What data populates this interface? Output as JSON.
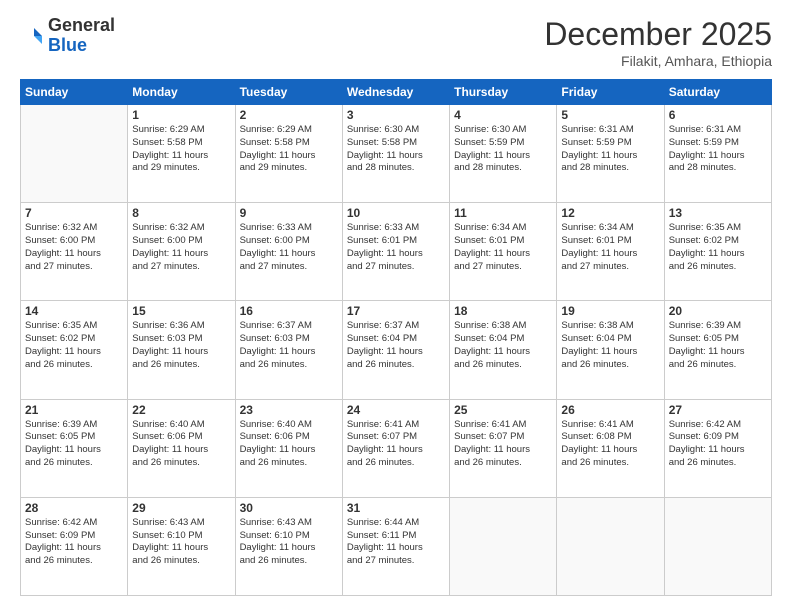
{
  "logo": {
    "general": "General",
    "blue": "Blue"
  },
  "header": {
    "month": "December 2025",
    "location": "Filakit, Amhara, Ethiopia"
  },
  "weekdays": [
    "Sunday",
    "Monday",
    "Tuesday",
    "Wednesday",
    "Thursday",
    "Friday",
    "Saturday"
  ],
  "weeks": [
    [
      {
        "day": "",
        "info": ""
      },
      {
        "day": "1",
        "info": "Sunrise: 6:29 AM\nSunset: 5:58 PM\nDaylight: 11 hours\nand 29 minutes."
      },
      {
        "day": "2",
        "info": "Sunrise: 6:29 AM\nSunset: 5:58 PM\nDaylight: 11 hours\nand 29 minutes."
      },
      {
        "day": "3",
        "info": "Sunrise: 6:30 AM\nSunset: 5:58 PM\nDaylight: 11 hours\nand 28 minutes."
      },
      {
        "day": "4",
        "info": "Sunrise: 6:30 AM\nSunset: 5:59 PM\nDaylight: 11 hours\nand 28 minutes."
      },
      {
        "day": "5",
        "info": "Sunrise: 6:31 AM\nSunset: 5:59 PM\nDaylight: 11 hours\nand 28 minutes."
      },
      {
        "day": "6",
        "info": "Sunrise: 6:31 AM\nSunset: 5:59 PM\nDaylight: 11 hours\nand 28 minutes."
      }
    ],
    [
      {
        "day": "7",
        "info": "Sunrise: 6:32 AM\nSunset: 6:00 PM\nDaylight: 11 hours\nand 27 minutes."
      },
      {
        "day": "8",
        "info": "Sunrise: 6:32 AM\nSunset: 6:00 PM\nDaylight: 11 hours\nand 27 minutes."
      },
      {
        "day": "9",
        "info": "Sunrise: 6:33 AM\nSunset: 6:00 PM\nDaylight: 11 hours\nand 27 minutes."
      },
      {
        "day": "10",
        "info": "Sunrise: 6:33 AM\nSunset: 6:01 PM\nDaylight: 11 hours\nand 27 minutes."
      },
      {
        "day": "11",
        "info": "Sunrise: 6:34 AM\nSunset: 6:01 PM\nDaylight: 11 hours\nand 27 minutes."
      },
      {
        "day": "12",
        "info": "Sunrise: 6:34 AM\nSunset: 6:01 PM\nDaylight: 11 hours\nand 27 minutes."
      },
      {
        "day": "13",
        "info": "Sunrise: 6:35 AM\nSunset: 6:02 PM\nDaylight: 11 hours\nand 26 minutes."
      }
    ],
    [
      {
        "day": "14",
        "info": "Sunrise: 6:35 AM\nSunset: 6:02 PM\nDaylight: 11 hours\nand 26 minutes."
      },
      {
        "day": "15",
        "info": "Sunrise: 6:36 AM\nSunset: 6:03 PM\nDaylight: 11 hours\nand 26 minutes."
      },
      {
        "day": "16",
        "info": "Sunrise: 6:37 AM\nSunset: 6:03 PM\nDaylight: 11 hours\nand 26 minutes."
      },
      {
        "day": "17",
        "info": "Sunrise: 6:37 AM\nSunset: 6:04 PM\nDaylight: 11 hours\nand 26 minutes."
      },
      {
        "day": "18",
        "info": "Sunrise: 6:38 AM\nSunset: 6:04 PM\nDaylight: 11 hours\nand 26 minutes."
      },
      {
        "day": "19",
        "info": "Sunrise: 6:38 AM\nSunset: 6:04 PM\nDaylight: 11 hours\nand 26 minutes."
      },
      {
        "day": "20",
        "info": "Sunrise: 6:39 AM\nSunset: 6:05 PM\nDaylight: 11 hours\nand 26 minutes."
      }
    ],
    [
      {
        "day": "21",
        "info": "Sunrise: 6:39 AM\nSunset: 6:05 PM\nDaylight: 11 hours\nand 26 minutes."
      },
      {
        "day": "22",
        "info": "Sunrise: 6:40 AM\nSunset: 6:06 PM\nDaylight: 11 hours\nand 26 minutes."
      },
      {
        "day": "23",
        "info": "Sunrise: 6:40 AM\nSunset: 6:06 PM\nDaylight: 11 hours\nand 26 minutes."
      },
      {
        "day": "24",
        "info": "Sunrise: 6:41 AM\nSunset: 6:07 PM\nDaylight: 11 hours\nand 26 minutes."
      },
      {
        "day": "25",
        "info": "Sunrise: 6:41 AM\nSunset: 6:07 PM\nDaylight: 11 hours\nand 26 minutes."
      },
      {
        "day": "26",
        "info": "Sunrise: 6:41 AM\nSunset: 6:08 PM\nDaylight: 11 hours\nand 26 minutes."
      },
      {
        "day": "27",
        "info": "Sunrise: 6:42 AM\nSunset: 6:09 PM\nDaylight: 11 hours\nand 26 minutes."
      }
    ],
    [
      {
        "day": "28",
        "info": "Sunrise: 6:42 AM\nSunset: 6:09 PM\nDaylight: 11 hours\nand 26 minutes."
      },
      {
        "day": "29",
        "info": "Sunrise: 6:43 AM\nSunset: 6:10 PM\nDaylight: 11 hours\nand 26 minutes."
      },
      {
        "day": "30",
        "info": "Sunrise: 6:43 AM\nSunset: 6:10 PM\nDaylight: 11 hours\nand 26 minutes."
      },
      {
        "day": "31",
        "info": "Sunrise: 6:44 AM\nSunset: 6:11 PM\nDaylight: 11 hours\nand 27 minutes."
      },
      {
        "day": "",
        "info": ""
      },
      {
        "day": "",
        "info": ""
      },
      {
        "day": "",
        "info": ""
      }
    ]
  ]
}
